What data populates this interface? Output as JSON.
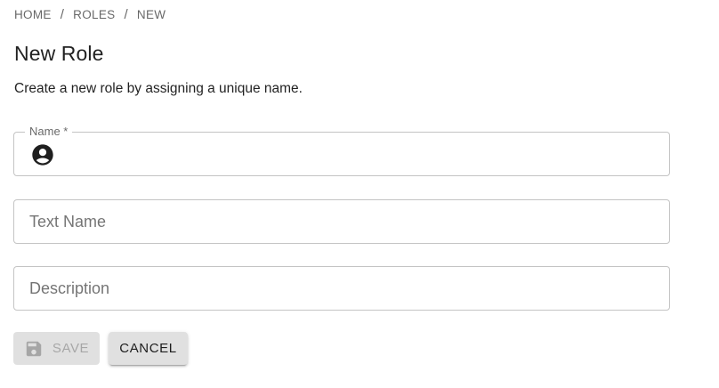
{
  "breadcrumb": {
    "items": [
      {
        "label": "HOME"
      },
      {
        "label": "ROLES"
      },
      {
        "label": "NEW"
      }
    ],
    "separator": "/"
  },
  "page": {
    "title": "New Role",
    "description": "Create a new role by assigning a unique name."
  },
  "form": {
    "name": {
      "label": "Name *",
      "value": "",
      "icon": "account-circle-icon"
    },
    "text_name": {
      "placeholder": "Text Name",
      "value": ""
    },
    "description": {
      "placeholder": "Description",
      "value": ""
    }
  },
  "actions": {
    "save_label": "SAVE",
    "save_icon": "floppy-disk-icon",
    "save_disabled": true,
    "cancel_label": "CANCEL"
  },
  "colors": {
    "text_primary": "#212121",
    "text_secondary": "#757575",
    "border": "#c4c4c4",
    "disabled_bg": "#e0e0e0",
    "cancel_bg": "#e0e0e0"
  }
}
